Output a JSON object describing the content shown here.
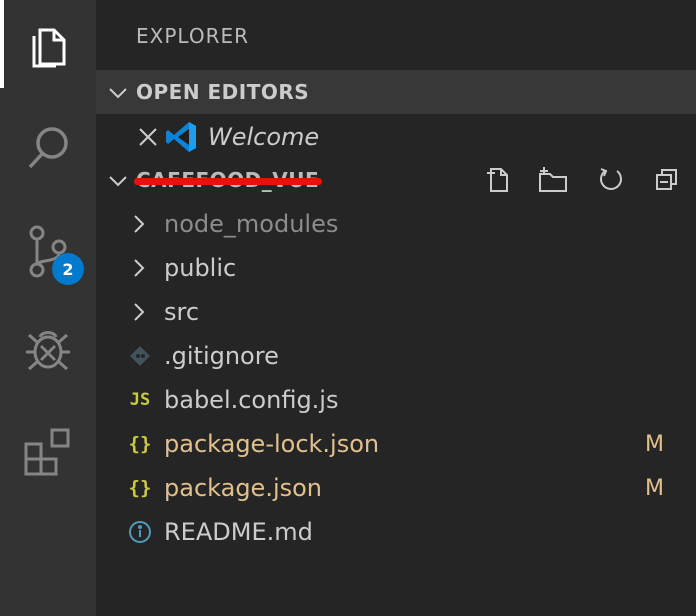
{
  "activity_bar": {
    "items": [
      "files-icon",
      "search-icon",
      "source-control-icon",
      "debug-icon",
      "extensions-icon"
    ],
    "source_control_badge": "2"
  },
  "explorer": {
    "title": "EXPLORER",
    "open_editors": {
      "label": "OPEN EDITORS",
      "editors": [
        {
          "name": "Welcome",
          "icon": "vscode-logo-icon"
        }
      ]
    },
    "workspace": {
      "label": "CAFEFOOD_VUE",
      "toolbar": [
        "new-file-icon",
        "new-folder-icon",
        "refresh-icon",
        "collapse-all-icon"
      ],
      "items": [
        {
          "name": "node_modules",
          "type": "folder",
          "status": ""
        },
        {
          "name": "public",
          "type": "folder",
          "status": ""
        },
        {
          "name": "src",
          "type": "folder",
          "status": ""
        },
        {
          "name": ".gitignore",
          "type": "git",
          "status": ""
        },
        {
          "name": "babel.config.js",
          "type": "js",
          "status": ""
        },
        {
          "name": "package-lock.json",
          "type": "json",
          "status": "M"
        },
        {
          "name": "package.json",
          "type": "json",
          "status": "M"
        },
        {
          "name": "README.md",
          "type": "info",
          "status": ""
        }
      ]
    }
  },
  "colors": {
    "modified": "#e2c08d",
    "accent": "#007acc",
    "ignored": "#8c8c8c",
    "redaction": "#e51400"
  }
}
